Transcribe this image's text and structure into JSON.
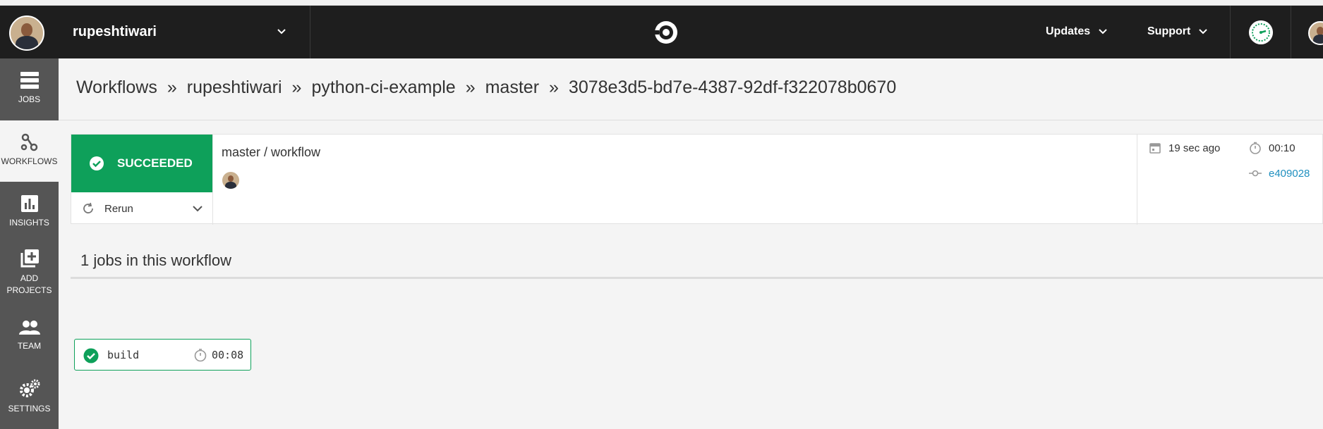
{
  "header": {
    "org_name": "rupeshtiwari",
    "nav": {
      "updates": "Updates",
      "support": "Support"
    }
  },
  "sidebar": {
    "items": [
      {
        "label": "JOBS",
        "icon": "jobs-icon"
      },
      {
        "label": "WORKFLOWS",
        "icon": "workflows-icon",
        "active": true
      },
      {
        "label": "INSIGHTS",
        "icon": "insights-icon"
      },
      {
        "label_line1": "ADD",
        "label_line2": "PROJECTS",
        "icon": "add-projects-icon"
      },
      {
        "label": "TEAM",
        "icon": "team-icon"
      },
      {
        "label": "SETTINGS",
        "icon": "settings-icon"
      }
    ]
  },
  "breadcrumb": {
    "items": [
      "Workflows",
      "rupeshtiwari",
      "python-ci-example",
      "master",
      "3078e3d5-bd7e-4387-92df-f322078b0670"
    ],
    "separator": "»"
  },
  "workflow": {
    "status": "SUCCEEDED",
    "status_color": "#0ea05a",
    "rerun_label": "Rerun",
    "title": "master / workflow",
    "time_ago": "19 sec ago",
    "duration": "00:10",
    "commit": "e409028"
  },
  "jobs": {
    "heading": "1 jobs in this workflow",
    "list": [
      {
        "name": "build",
        "duration": "00:08",
        "status": "success"
      }
    ]
  }
}
